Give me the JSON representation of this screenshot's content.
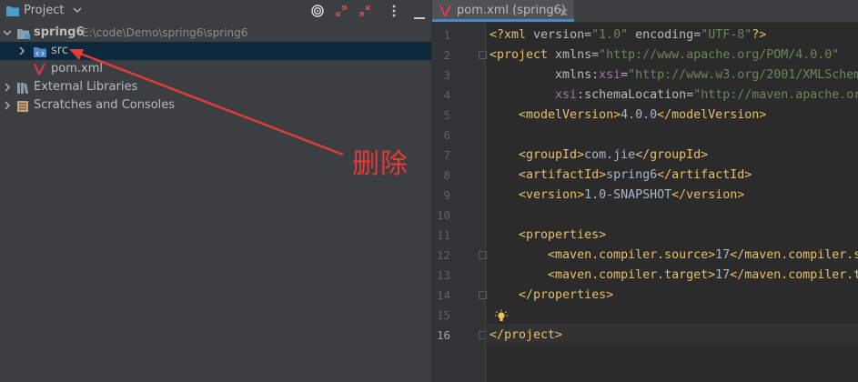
{
  "project_panel": {
    "header": {
      "title": "Project",
      "icons": [
        "project-folder-icon",
        "chevron-down-icon",
        "locate-target-icon",
        "expand-all-icon",
        "collapse-all-icon",
        "options-menu-icon",
        "hide-panel-icon"
      ]
    },
    "tree": [
      {
        "label": "spring6",
        "path": "E:\\code\\Demo\\spring6\\spring6",
        "icon": "module-folder-icon",
        "expanded": true
      },
      {
        "label": "src",
        "icon": "source-folder-icon",
        "expanded": false,
        "selected": true
      },
      {
        "label": "pom.xml",
        "icon": "maven-icon"
      },
      {
        "label": "External Libraries",
        "icon": "libraries-icon",
        "expanded": false
      },
      {
        "label": "Scratches and Consoles",
        "icon": "scratches-icon",
        "expanded": false
      }
    ]
  },
  "editor": {
    "tab": {
      "label": "pom.xml (spring6)",
      "icon": "maven-icon"
    },
    "line_numbers": [
      "1",
      "2",
      "3",
      "4",
      "5",
      "6",
      "7",
      "8",
      "9",
      "10",
      "11",
      "12",
      "13",
      "14",
      "15",
      "16"
    ],
    "current_line": 16
  },
  "annotation": {
    "text": "删除"
  },
  "colors": {
    "panel_bg": "#3c3f41",
    "editor_bg": "#2b2b2b",
    "selection": "#0d293e",
    "xml_tag": "#e8bf6a",
    "xml_attr": "#bababa",
    "xml_string": "#6a8759",
    "xml_namespace": "#9876aa",
    "text": "#a9b7c6",
    "annotation_red": "#e43a3a"
  }
}
